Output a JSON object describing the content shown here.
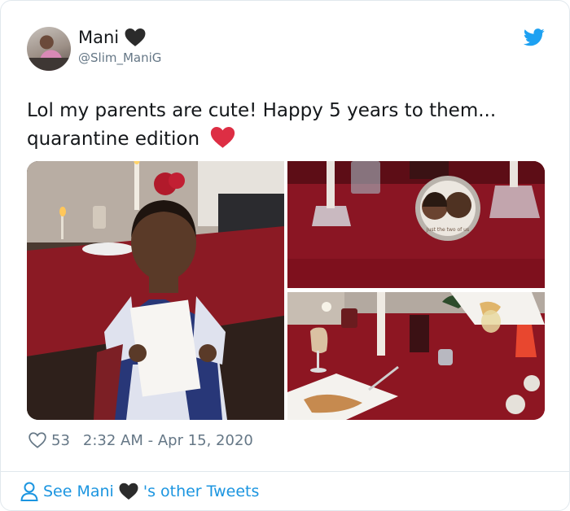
{
  "author": {
    "display_name": "Mani",
    "handle": "@Slim_ManiG",
    "name_emoji": "black-heart-icon"
  },
  "tweet": {
    "text_line1": "Lol my parents are cute! Happy 5 years to them...",
    "text_line2": "quarantine edition",
    "emoji": "red-heart-icon"
  },
  "media": {
    "photo_count": 3,
    "frame_caption": "Just the two of us"
  },
  "footer": {
    "like_count": "53",
    "timestamp": "2:32 AM - Apr 15, 2020"
  },
  "other_tweets": {
    "prefix": "See Mani",
    "suffix": "'s other Tweets"
  },
  "colors": {
    "brand": "#1da1f2",
    "link": "#1b95e0",
    "heart": "#e0245e",
    "muted": "#657786"
  }
}
